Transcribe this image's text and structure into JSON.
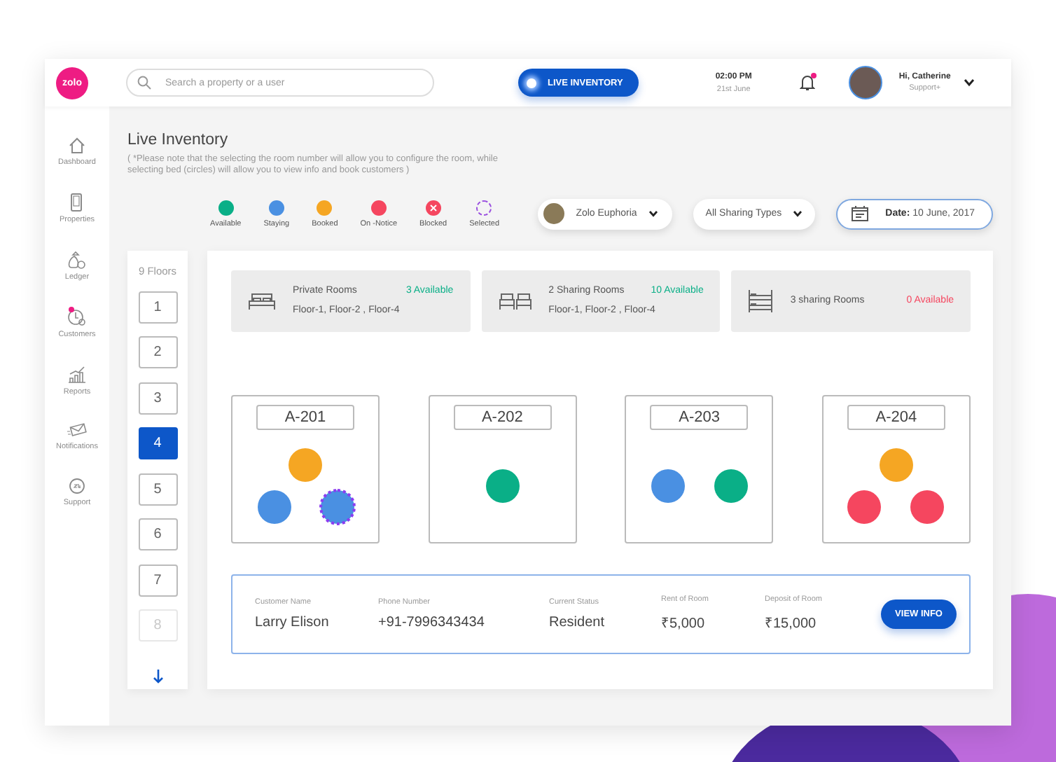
{
  "header": {
    "logo": "zolo",
    "search": {
      "placeholder": "Search a property or a user"
    },
    "live_button": "LIVE INVENTORY",
    "time": "02:00 PM",
    "date": "21st June",
    "notifications_unread": true,
    "user": {
      "greeting": "Hi, Catherine",
      "role": "Support+"
    }
  },
  "sidebar": {
    "items": [
      {
        "kind": "dashboard",
        "label": "Dashboard",
        "badge": false
      },
      {
        "kind": "properties",
        "label": "Properties",
        "badge": false
      },
      {
        "kind": "ledger",
        "label": "Ledger",
        "badge": false
      },
      {
        "kind": "customers",
        "label": "Customers",
        "badge": true
      },
      {
        "kind": "reports",
        "label": "Reports",
        "badge": false
      },
      {
        "kind": "notifications",
        "label": "Notifications",
        "badge": false
      },
      {
        "kind": "support",
        "label": "Support",
        "badge": false
      }
    ]
  },
  "page": {
    "title": "Live Inventory",
    "note": "( *Please note that the selecting the room number will allow you to configure the room, while selecting bed (circles) will allow you to view info and book customers  )"
  },
  "legend": [
    {
      "kind": "available",
      "label": "Available"
    },
    {
      "kind": "staying",
      "label": "Staying"
    },
    {
      "kind": "booked",
      "label": "Booked"
    },
    {
      "kind": "notice",
      "label": "On -Notice"
    },
    {
      "kind": "blocked",
      "label": "Blocked"
    },
    {
      "kind": "selected",
      "label": "Selected"
    }
  ],
  "filters": {
    "property": "Zolo Euphoria",
    "sharing": "All Sharing Types",
    "date": "**Date:** 10 June, 2017"
  },
  "floors": {
    "title": "9 Floors",
    "items": [
      {
        "label": "1",
        "selected": false
      },
      {
        "label": "2",
        "selected": false
      },
      {
        "label": "3",
        "selected": false
      },
      {
        "label": "4",
        "selected": true
      },
      {
        "label": "5",
        "selected": false
      },
      {
        "label": "6",
        "selected": false
      },
      {
        "label": "7",
        "selected": false
      },
      {
        "label": "8",
        "selected": false
      }
    ]
  },
  "room_types": [
    {
      "kind": "single",
      "name": "Private Rooms",
      "availability": "3 Available",
      "available": true,
      "floors": "Floor-1, Floor-2 , Floor-4"
    },
    {
      "kind": "double",
      "name": "2 Sharing Rooms",
      "availability": "10 Available",
      "available": true,
      "floors": "Floor-1, Floor-2 , Floor-4"
    },
    {
      "kind": "triple",
      "name": "3 sharing Rooms",
      "availability": "0 Available",
      "available": false
    }
  ],
  "rooms": [
    {
      "number": "A-201",
      "beds": [
        {
          "kind": "booked",
          "selected": false
        },
        {
          "kind": "staying",
          "selected": false
        },
        {
          "kind": "staying",
          "selected": true
        }
      ]
    },
    {
      "number": "A-202",
      "beds": [
        {
          "kind": "available",
          "selected": false
        }
      ]
    },
    {
      "number": "A-203",
      "beds": [
        {
          "kind": "staying",
          "selected": false
        },
        {
          "kind": "available",
          "selected": false
        }
      ]
    },
    {
      "number": "A-204",
      "beds": [
        {
          "kind": "booked",
          "selected": false
        },
        {
          "kind": "notice",
          "selected": false
        },
        {
          "kind": "notice",
          "selected": false
        }
      ]
    }
  ],
  "customer": {
    "fields": [
      {
        "label": "Customer Name",
        "value": "Larry Elison"
      },
      {
        "label": "Phone Number",
        "value": "+91-7996343434"
      },
      {
        "label": "Current Status",
        "value": "Resident"
      },
      {
        "label": "Rent of Room",
        "value": "₹5,000"
      },
      {
        "label": "Deposit of Room",
        "value": "₹15,000"
      }
    ],
    "button": "VIEW INFO"
  }
}
